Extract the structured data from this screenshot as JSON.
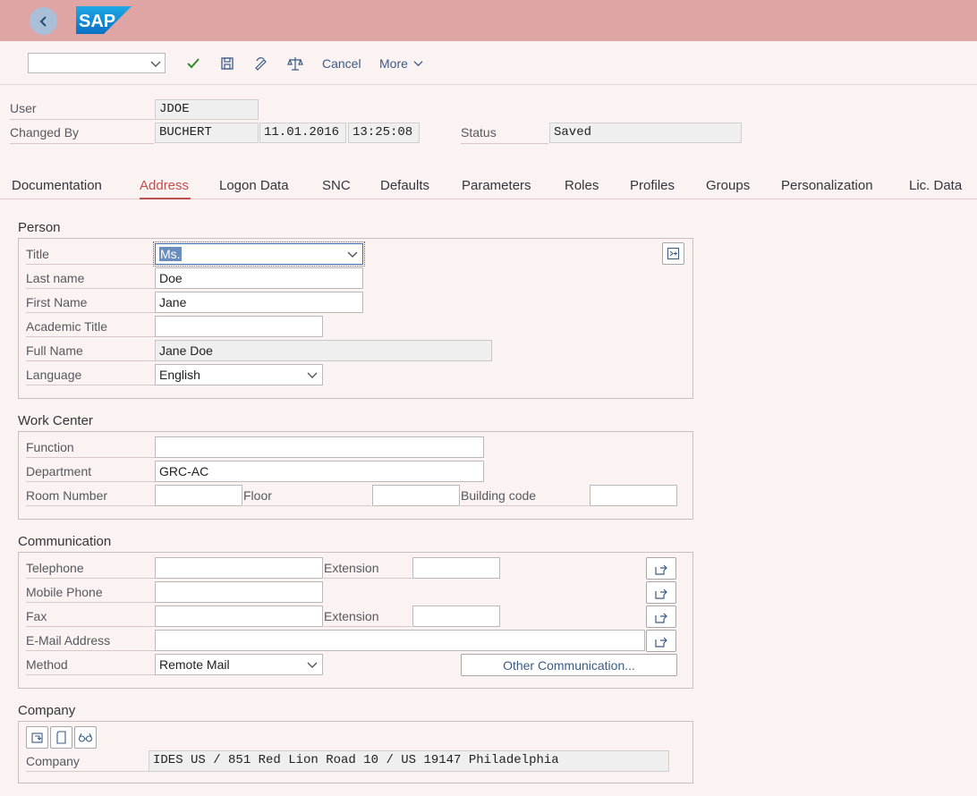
{
  "shell": {
    "logo_text": "SAP"
  },
  "toolbar": {
    "command_value": "",
    "cancel_label": "Cancel",
    "more_label": "More"
  },
  "header": {
    "user_label": "User",
    "user_value": "JDOE",
    "changed_by_label": "Changed By",
    "changed_by_value": "BUCHERT",
    "changed_date": "11.01.2016",
    "changed_time": "13:25:08",
    "status_label": "Status",
    "status_value": "Saved"
  },
  "tabs": [
    "Documentation",
    "Address",
    "Logon Data",
    "SNC",
    "Defaults",
    "Parameters",
    "Roles",
    "Profiles",
    "Groups",
    "Personalization",
    "Lic. Data"
  ],
  "person": {
    "section_title": "Person",
    "title_label": "Title",
    "title_value": "Ms.",
    "last_name_label": "Last name",
    "last_name_value": "Doe",
    "first_name_label": "First Name",
    "first_name_value": "Jane",
    "academic_title_label": "Academic Title",
    "academic_title_value": "",
    "full_name_label": "Full Name",
    "full_name_value": "Jane Doe",
    "language_label": "Language",
    "language_value": "English"
  },
  "work_center": {
    "section_title": "Work Center",
    "function_label": "Function",
    "function_value": "",
    "department_label": "Department",
    "department_value": "GRC-AC",
    "room_label": "Room Number",
    "room_value": "",
    "floor_label": "Floor",
    "floor_value": "",
    "building_label": "Building code",
    "building_value": ""
  },
  "communication": {
    "section_title": "Communication",
    "telephone_label": "Telephone",
    "telephone_value": "",
    "extension_label": "Extension",
    "tel_extension_value": "",
    "mobile_label": "Mobile Phone",
    "mobile_value": "",
    "fax_label": "Fax",
    "fax_value": "",
    "fax_extension_label": "Extension",
    "fax_extension_value": "",
    "email_label": "E-Mail Address",
    "email_value": "",
    "method_label": "Method",
    "method_value": "Remote Mail",
    "other_comm_label": "Other Communication..."
  },
  "company": {
    "section_title": "Company",
    "company_label": "Company",
    "company_value": "IDES US / 851 Red Lion Road 10 / US 19147 Philadelphia"
  }
}
